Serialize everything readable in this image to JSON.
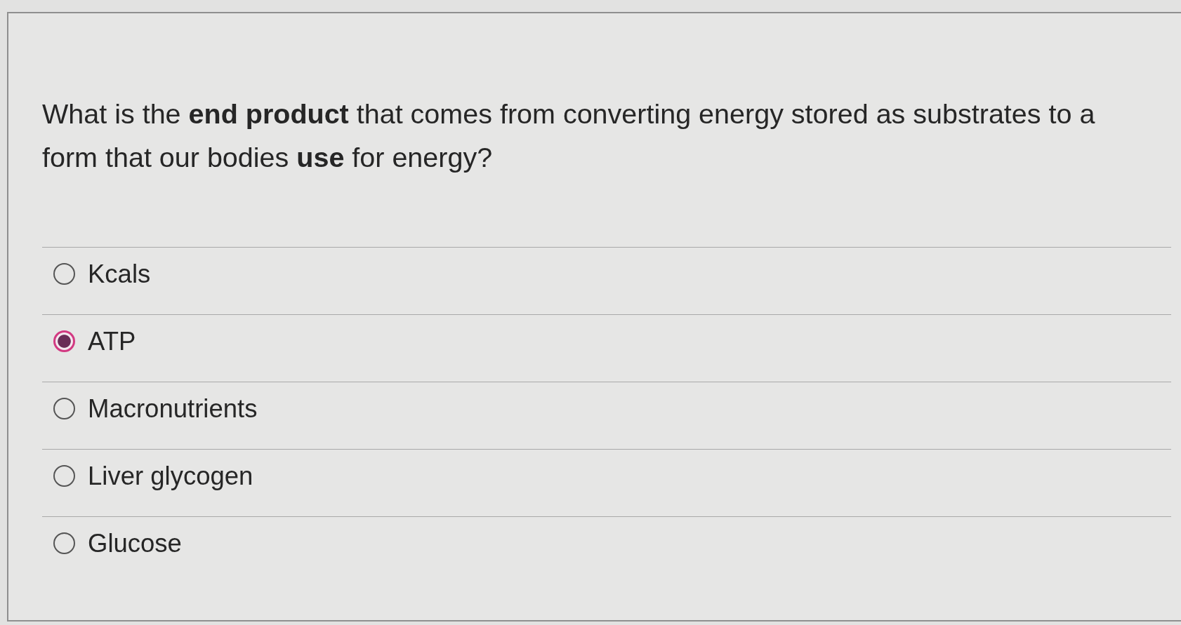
{
  "question": "What is the **end product** that comes from converting energy stored as substrates to a form that our bodies **use** for energy?",
  "options": [
    {
      "label": "Kcals",
      "selected": false
    },
    {
      "label": "ATP",
      "selected": true
    },
    {
      "label": "Macronutrients",
      "selected": false
    },
    {
      "label": "Liver glycogen",
      "selected": false
    },
    {
      "label": "Glucose",
      "selected": false
    }
  ]
}
